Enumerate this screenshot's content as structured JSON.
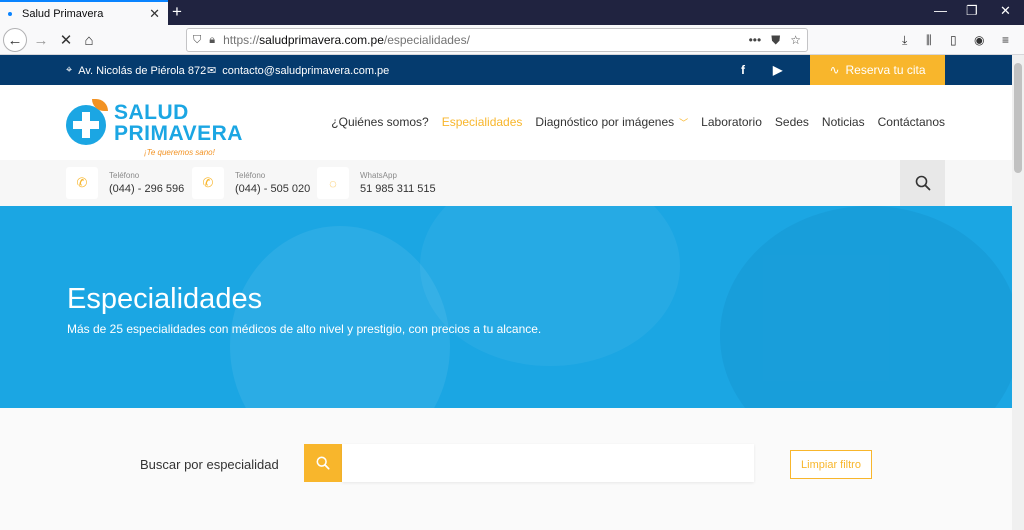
{
  "browser": {
    "tab_title": "Salud Primavera",
    "url_prefix": "https://",
    "url_domain": "saludprimavera.com.pe",
    "url_path": "/especialidades/"
  },
  "topbar": {
    "address": "Av. Nicolás de Piérola 872",
    "email": "contacto@saludprimavera.com.pe",
    "reserve_label": "Reserva tu cita"
  },
  "logo": {
    "line1": "SALUD",
    "line2": "PRIMAVERA",
    "tagline": "¡Te queremos sano!"
  },
  "menu": {
    "items": [
      {
        "label": "¿Quiénes somos?"
      },
      {
        "label": "Especialidades"
      },
      {
        "label": "Diagnóstico por imágenes"
      },
      {
        "label": "Laboratorio"
      },
      {
        "label": "Sedes"
      },
      {
        "label": "Noticias"
      },
      {
        "label": "Contáctanos"
      }
    ]
  },
  "contacts": [
    {
      "label": "Teléfono",
      "value": "(044) - 296 596"
    },
    {
      "label": "Teléfono",
      "value": "(044) - 505 020"
    },
    {
      "label": "WhatsApp",
      "value": "51 985 311 515"
    }
  ],
  "hero": {
    "title": "Especialidades",
    "subtitle": "Más de 25 especialidades con médicos de alto nivel y prestigio, con precios a tu alcance."
  },
  "filter": {
    "label": "Buscar por especialidad",
    "input_value": "",
    "clear_label": "Limpiar filtro"
  },
  "colors": {
    "brand_blue": "#1ba6e3",
    "dark_blue": "#053b6e",
    "accent_orange": "#f8b62c"
  }
}
